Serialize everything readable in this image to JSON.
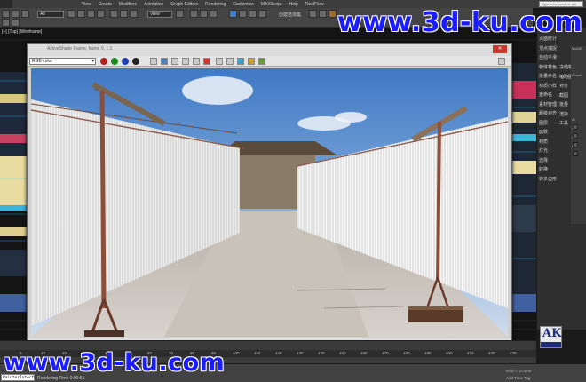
{
  "menubar": {
    "items": [
      "View",
      "Create",
      "Modifiers",
      "Animation",
      "Graph Editors",
      "Rendering",
      "Customize",
      "MAXScript",
      "Help",
      "RealFlow"
    ],
    "search_placeholder": "Type a keyword or phr"
  },
  "toolbar": {
    "select_all": "All",
    "view_select": "View",
    "chinese_label": "创建选择集"
  },
  "viewport": {
    "label": "[+] [Top] [Wireframe]"
  },
  "render_window": {
    "title": "ActiveShade Frame, frame 0, 1:1",
    "channel": "RGB color",
    "close": "✕"
  },
  "command_panel": {
    "col1": [
      "页面统计",
      "顶点捕捉",
      "自动平滑",
      "物体着色",
      "批量命名",
      "材质小样",
      "重命名",
      "素材管理",
      "超级对齐",
      "图层",
      "面数",
      "材质",
      "灯光",
      "选择",
      "转换",
      "转多边形"
    ],
    "col2": [
      "冻结物体",
      "缩略图",
      "对齐",
      "截图",
      "批量",
      "渲染",
      "工具"
    ],
    "side": [
      "Modifi",
      "Shade",
      "Ai",
      "Gi",
      "Ai",
      "Hi"
    ]
  },
  "timeline": {
    "ticks": [
      "0",
      "10",
      "20",
      "30",
      "40",
      "50",
      "60",
      "70",
      "80",
      "90",
      "100",
      "110",
      "120",
      "130",
      "140",
      "150",
      "160",
      "170",
      "180",
      "190",
      "200",
      "210",
      "220",
      "230"
    ]
  },
  "statusbar": {
    "maxscript": "PainterInterfa",
    "render_time": "Rendering Time 0:00:51",
    "grid": "Grid = 10.0cm",
    "add_time_tag": "Add Time Tag"
  },
  "badge": {
    "letters": "AK"
  },
  "watermarks": {
    "top": "www.3d-ku.com",
    "bottom": "www.3d-ku.com"
  },
  "colors": {
    "accent_blue": "#1b1bff",
    "close_red": "#c9342b",
    "ak_blue": "#1b2d7a"
  }
}
